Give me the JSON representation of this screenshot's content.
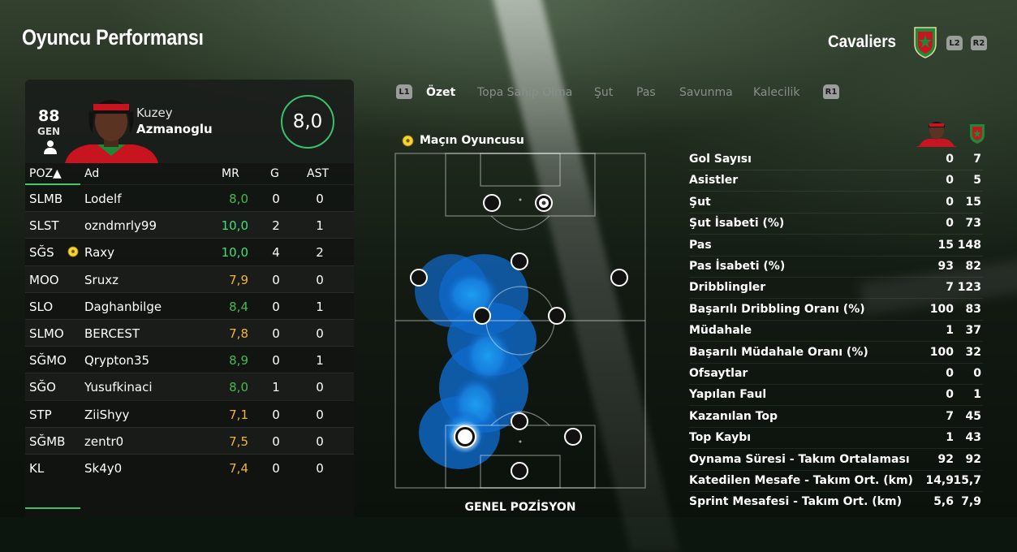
{
  "header": {
    "title": "Oyuncu Performansı",
    "team_name": "Cavaliers",
    "l2": "L2",
    "r2": "R2"
  },
  "player": {
    "overall": "88",
    "overall_label": "GEN",
    "first_name": "Kuzey",
    "last_name": "Azmanoglu",
    "match_rating": "8,0"
  },
  "table": {
    "headers": {
      "pos": "POZ▲",
      "name": "Ad",
      "mr": "MR",
      "g": "G",
      "ast": "AST"
    },
    "rows": [
      {
        "pos": "SLMB",
        "name": "Lodelf",
        "mr": "8,0",
        "g": "0",
        "ast": "0",
        "mr_color": "#47b94f"
      },
      {
        "pos": "SLST",
        "name": "ozndmrly99",
        "mr": "10,0",
        "g": "2",
        "ast": "1",
        "mr_color": "#3fe07a"
      },
      {
        "pos": "SĞS",
        "name": "Raxy",
        "mr": "10,0",
        "g": "4",
        "ast": "2",
        "mr_color": "#3fe07a",
        "potm": true
      },
      {
        "pos": "MOO",
        "name": "Sruxz",
        "mr": "7,9",
        "g": "0",
        "ast": "0",
        "mr_color": "#f2b43a"
      },
      {
        "pos": "SLO",
        "name": "Daghanbilge",
        "mr": "8,4",
        "g": "0",
        "ast": "1",
        "mr_color": "#47b94f"
      },
      {
        "pos": "SLMO",
        "name": "BERCEST",
        "mr": "7,8",
        "g": "0",
        "ast": "0",
        "mr_color": "#f2b43a"
      },
      {
        "pos": "SĞMO",
        "name": "Qrypton35",
        "mr": "8,9",
        "g": "0",
        "ast": "1",
        "mr_color": "#47b94f"
      },
      {
        "pos": "SĞO",
        "name": "Yusufkinaci",
        "mr": "8,0",
        "g": "1",
        "ast": "0",
        "mr_color": "#47b94f"
      },
      {
        "pos": "STP",
        "name": "ZiiShyy",
        "mr": "7,1",
        "g": "0",
        "ast": "0",
        "mr_color": "#f2b43a"
      },
      {
        "pos": "SĞMB",
        "name": "zentr0",
        "mr": "7,5",
        "g": "0",
        "ast": "0",
        "mr_color": "#f2b43a"
      },
      {
        "pos": "KL",
        "name": "Sk4y0",
        "mr": "7,4",
        "g": "0",
        "ast": "0",
        "mr_color": "#f2b43a"
      }
    ]
  },
  "tabs": {
    "l1": "L1",
    "r1": "R1",
    "items": [
      "Özet",
      "Topa Sahip Olma",
      "Şut",
      "Pas",
      "Savunma",
      "Kalecilik"
    ],
    "active": "Özet"
  },
  "potm_label": "Maçın Oyuncusu",
  "pitch_caption": "GENEL POZİSYON",
  "stats": [
    {
      "label": "Gol Sayısı",
      "player": "0",
      "team": "7"
    },
    {
      "label": "Asistler",
      "player": "0",
      "team": "5"
    },
    {
      "label": "Şut",
      "player": "0",
      "team": "15"
    },
    {
      "label": "Şut İsabeti (%)",
      "player": "0",
      "team": "73"
    },
    {
      "label": "Pas",
      "player": "15",
      "team": "148"
    },
    {
      "label": "Pas İsabeti (%)",
      "player": "93",
      "team": "82"
    },
    {
      "label": "Dribblingler",
      "player": "7",
      "team": "123"
    },
    {
      "label": "Başarılı Dribbling Oranı (%)",
      "player": "100",
      "team": "83"
    },
    {
      "label": "Müdahale",
      "player": "1",
      "team": "37"
    },
    {
      "label": "Başarılı Müdahale Oranı (%)",
      "player": "100",
      "team": "32"
    },
    {
      "label": "Ofsaytlar",
      "player": "0",
      "team": "0"
    },
    {
      "label": "Yapılan Faul",
      "player": "0",
      "team": "1"
    },
    {
      "label": "Kazanılan Top",
      "player": "7",
      "team": "45"
    },
    {
      "label": "Top Kaybı",
      "player": "1",
      "team": "43"
    },
    {
      "label": "Oynama Süresi - Takım Ortalaması",
      "player": "92",
      "team": "92"
    },
    {
      "label": "Katedilen Mesafe - Takım Ort. (km)",
      "player": "14,9",
      "team": "15,7"
    },
    {
      "label": "Sprint Mesafesi - Takım Ort. (km)",
      "player": "5,6",
      "team": "7,9"
    }
  ],
  "colors": {
    "accent_green": "#3ac26b",
    "heatmap_blue": "#1e9bff",
    "rating_orange": "#f2b43a"
  }
}
